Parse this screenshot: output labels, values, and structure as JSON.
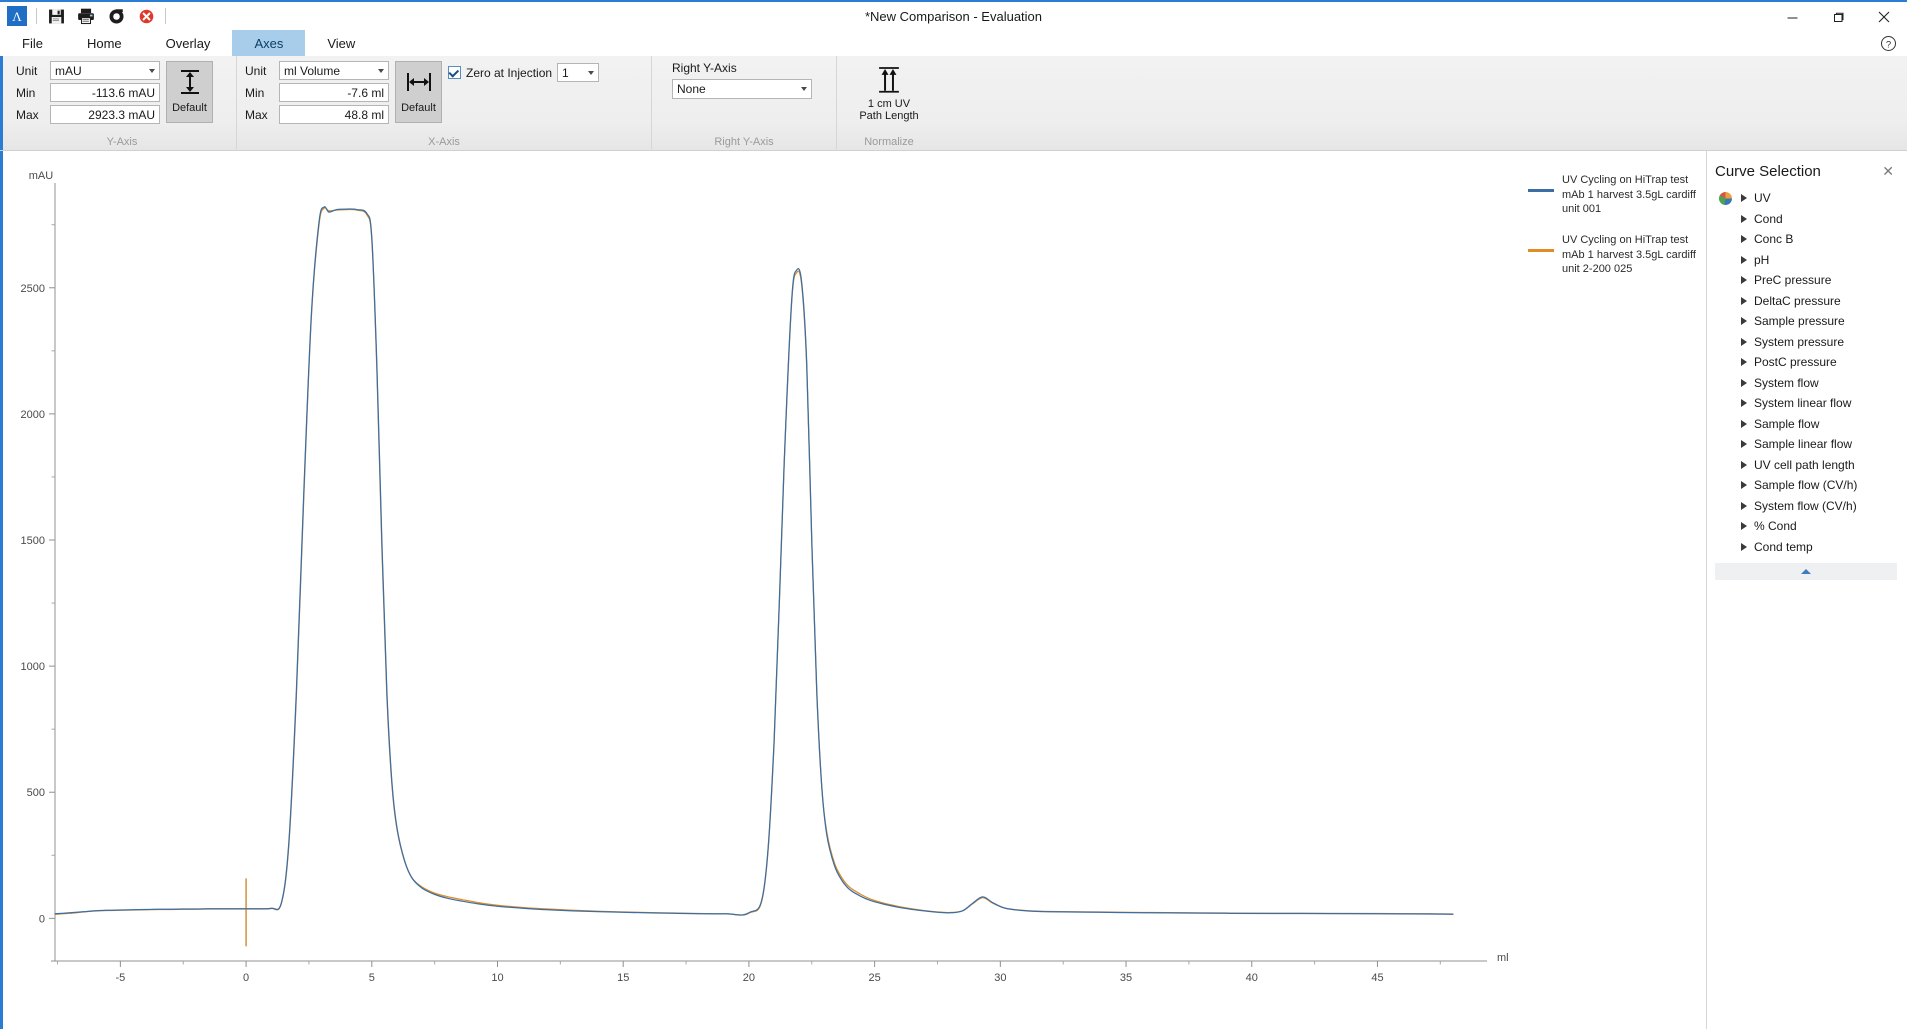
{
  "window": {
    "title": "*New Comparison - Evaluation",
    "minimize": "─",
    "maximize": "❐",
    "close": "✕",
    "app_logo_glyph": "Λ"
  },
  "quick_access": [
    {
      "name": "save-icon",
      "glyph": "💾"
    },
    {
      "name": "print-icon",
      "glyph": "🖨"
    },
    {
      "name": "undo-icon",
      "glyph": "↺"
    },
    {
      "name": "delete-icon",
      "glyph": "✖"
    }
  ],
  "ribbon": {
    "tabs": [
      {
        "label": "File",
        "active": false
      },
      {
        "label": "Home",
        "active": false
      },
      {
        "label": "Overlay",
        "active": false
      },
      {
        "label": "Axes",
        "active": true
      },
      {
        "label": "View",
        "active": false
      }
    ],
    "help_glyph": "?",
    "groups": {
      "y_axis": {
        "group_label": "Y-Axis",
        "unit_label": "Unit",
        "unit_value": "mAU",
        "min_label": "Min",
        "min_value": "-113.6 mAU",
        "max_label": "Max",
        "max_value": "2923.3 mAU",
        "default_button": "Default"
      },
      "x_axis": {
        "group_label": "X-Axis",
        "unit_label": "Unit",
        "unit_value": "ml Volume",
        "min_label": "Min",
        "min_value": "-7.6 ml",
        "max_label": "Max",
        "max_value": "48.8 ml",
        "default_button": "Default",
        "zero_at_injection_label": "Zero at Injection",
        "zero_at_injection_checked": true,
        "zero_at_injection_value": "1"
      },
      "right_y_axis": {
        "group_label": "Right Y-Axis",
        "title": "Right Y-Axis",
        "value": "None"
      },
      "normalize": {
        "group_label": "Normalize",
        "button_label": "1 cm UV\nPath Length"
      }
    }
  },
  "curve_selection": {
    "title": "Curve Selection",
    "close_glyph": "✕",
    "items": [
      {
        "label": "UV",
        "has_swatch": true
      },
      {
        "label": "Cond",
        "has_swatch": false
      },
      {
        "label": "Conc B",
        "has_swatch": false
      },
      {
        "label": "pH",
        "has_swatch": false
      },
      {
        "label": "PreC pressure",
        "has_swatch": false
      },
      {
        "label": "DeltaC pressure",
        "has_swatch": false
      },
      {
        "label": "Sample pressure",
        "has_swatch": false
      },
      {
        "label": "System pressure",
        "has_swatch": false
      },
      {
        "label": "PostC pressure",
        "has_swatch": false
      },
      {
        "label": "System flow",
        "has_swatch": false
      },
      {
        "label": "System linear flow",
        "has_swatch": false
      },
      {
        "label": "Sample flow",
        "has_swatch": false
      },
      {
        "label": "Sample linear flow",
        "has_swatch": false
      },
      {
        "label": "UV cell path length",
        "has_swatch": false
      },
      {
        "label": "Sample flow (CV/h)",
        "has_swatch": false
      },
      {
        "label": "System flow (CV/h)",
        "has_swatch": false
      },
      {
        "label": "% Cond",
        "has_swatch": false
      },
      {
        "label": "Cond temp",
        "has_swatch": false
      }
    ]
  },
  "chart_data": {
    "type": "line",
    "title": "",
    "xlabel": "ml",
    "ylabel": "mAU",
    "xlim": [
      -7.6,
      48.8
    ],
    "ylim": [
      -113.6,
      2923.3
    ],
    "xticks": [
      -5,
      0,
      5,
      10,
      15,
      20,
      25,
      30,
      35,
      40,
      45
    ],
    "yticks": [
      0,
      500,
      1000,
      1500,
      2000,
      2500
    ],
    "xminor_step": 2.5,
    "yminor_step": 250,
    "grid": false,
    "legend_position": "right",
    "injection_marker_x": 0,
    "injection_marker_color": "#d08a2e",
    "series": [
      {
        "name": "UV Cycling on HiTrap test mAb 1 harvest 3.5gL cardiff unit  001",
        "color": "#3b6ea5",
        "x": [
          -7.6,
          -7.0,
          -6.5,
          -6.0,
          -5.5,
          -5.0,
          -4.5,
          -4.0,
          -3.5,
          -3.0,
          -2.5,
          -2.0,
          -1.5,
          -1.0,
          -0.5,
          0.0,
          0.5,
          1.0,
          1.4,
          1.7,
          2.0,
          2.3,
          2.6,
          2.9,
          3.1,
          3.3,
          3.6,
          4.0,
          4.4,
          4.8,
          5.0,
          5.2,
          5.4,
          5.6,
          5.8,
          6.0,
          6.3,
          6.6,
          7.0,
          7.5,
          8.0,
          8.6,
          9.2,
          10.0,
          11.0,
          12.0,
          13.5,
          15.0,
          17.0,
          19.0,
          20.0,
          20.6,
          21.0,
          21.4,
          21.7,
          21.9,
          22.1,
          22.3,
          22.5,
          22.7,
          22.9,
          23.1,
          23.4,
          23.7,
          24.0,
          24.4,
          24.8,
          25.3,
          25.9,
          26.6,
          27.3,
          28.0,
          28.5,
          28.9,
          29.3,
          29.7,
          30.2,
          31.0,
          32.0,
          34.0,
          36.0,
          39.0,
          42.0,
          45.0,
          47.0,
          48.0
        ],
        "y": [
          18,
          22,
          26,
          30,
          32,
          33,
          34,
          35,
          36,
          36,
          37,
          37,
          38,
          38,
          38,
          38,
          38,
          40,
          60,
          300,
          900,
          1700,
          2400,
          2760,
          2820,
          2800,
          2810,
          2812,
          2810,
          2795,
          2700,
          2200,
          1500,
          900,
          540,
          360,
          230,
          160,
          120,
          95,
          80,
          68,
          58,
          48,
          40,
          34,
          28,
          24,
          20,
          18,
          22,
          120,
          700,
          1800,
          2450,
          2570,
          2520,
          2200,
          1500,
          900,
          520,
          330,
          210,
          150,
          115,
          90,
          72,
          58,
          45,
          34,
          26,
          22,
          30,
          60,
          85,
          62,
          40,
          30,
          26,
          24,
          22,
          20,
          19,
          18,
          17,
          16
        ]
      },
      {
        "name": "UV Cycling on HiTrap test mAb 1 harvest 3.5gL cardiff unit 2-200 025",
        "color": "#e08b23",
        "x": [
          -7.6,
          -7.0,
          -6.5,
          -6.0,
          -5.5,
          -5.0,
          -4.5,
          -4.0,
          -3.5,
          -3.0,
          -2.5,
          -2.0,
          -1.5,
          -1.0,
          -0.5,
          0.0,
          0.5,
          1.0,
          1.4,
          1.7,
          2.0,
          2.3,
          2.6,
          2.9,
          3.1,
          3.3,
          3.6,
          4.0,
          4.4,
          4.8,
          5.0,
          5.2,
          5.4,
          5.6,
          5.8,
          6.0,
          6.3,
          6.6,
          7.0,
          7.5,
          8.0,
          8.6,
          9.2,
          10.0,
          11.0,
          12.0,
          13.5,
          15.0,
          17.0,
          19.0,
          20.0,
          20.6,
          21.0,
          21.4,
          21.7,
          21.9,
          22.1,
          22.3,
          22.5,
          22.7,
          22.9,
          23.1,
          23.4,
          23.7,
          24.0,
          24.4,
          24.8,
          25.3,
          25.9,
          26.6,
          27.3,
          28.0,
          28.5,
          28.9,
          29.3,
          29.7,
          30.2,
          31.0,
          32.0,
          34.0,
          36.0,
          39.0,
          42.0,
          45.0,
          47.0,
          48.0
        ],
        "y": [
          16,
          20,
          25,
          29,
          31,
          32,
          33,
          34,
          35,
          35,
          36,
          36,
          37,
          37,
          37,
          37,
          37,
          39,
          58,
          290,
          880,
          1680,
          2390,
          2750,
          2815,
          2805,
          2808,
          2810,
          2808,
          2790,
          2690,
          2180,
          1470,
          880,
          530,
          355,
          228,
          160,
          124,
          100,
          86,
          74,
          63,
          52,
          43,
          37,
          30,
          25,
          21,
          18,
          21,
          115,
          690,
          1790,
          2440,
          2560,
          2510,
          2185,
          1490,
          890,
          515,
          340,
          220,
          160,
          124,
          98,
          78,
          62,
          48,
          36,
          27,
          23,
          30,
          58,
          82,
          60,
          40,
          31,
          27,
          25,
          23,
          21,
          20,
          19,
          18,
          17
        ]
      }
    ]
  }
}
